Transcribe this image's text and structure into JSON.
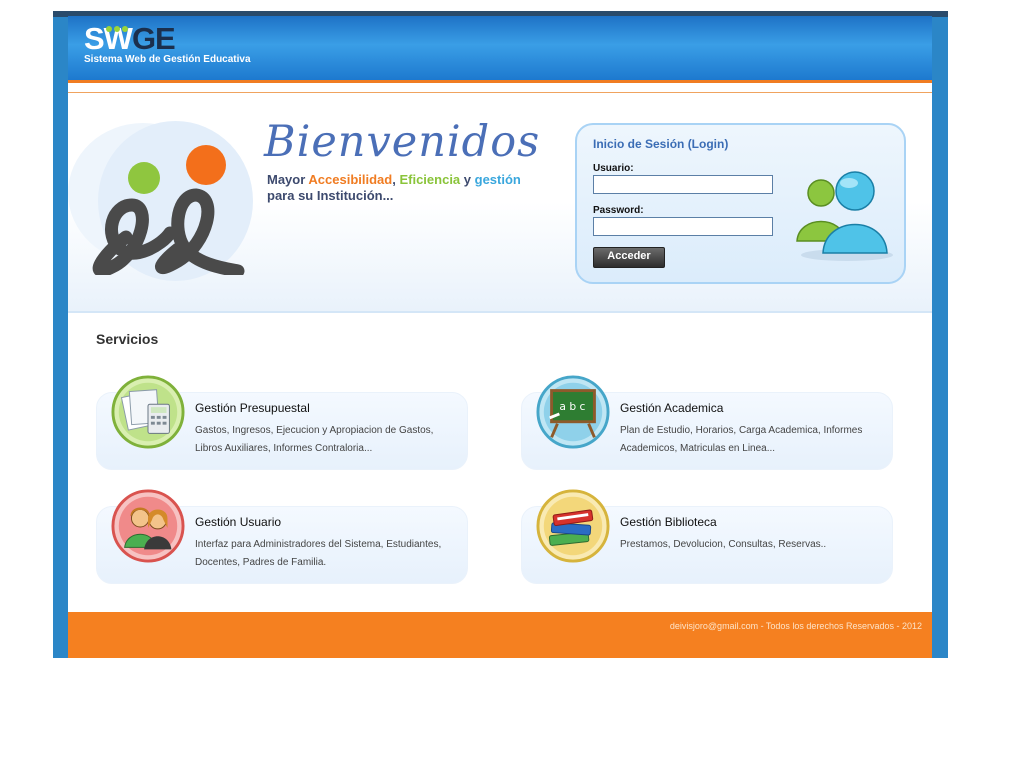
{
  "brand": {
    "logo_text_sw": "SW",
    "logo_text_ge": "GE",
    "subtitle": "Sistema Web de Gestión Educativa"
  },
  "hero": {
    "welcome": "Bienvenidos",
    "tagline": {
      "prefix": "Mayor ",
      "word1": "Accesibilidad",
      "sep1": ", ",
      "word2": "Eficiencia",
      "sep2": " y ",
      "word3": "gestión",
      "line2": "para su Institución..."
    }
  },
  "login": {
    "title": "Inicio de Sesión (Login)",
    "user_label": "Usuario:",
    "user_value": "",
    "password_label": "Password:",
    "password_value": "",
    "submit_label": "Acceder"
  },
  "services": {
    "title": "Servicios",
    "items": [
      {
        "title": "Gestión Presupuestal",
        "desc": "Gastos, Ingresos, Ejecucion y Apropiacion de Gastos, Libros Auxiliares, Informes Contraloria...",
        "icon": "calculator-icon"
      },
      {
        "title": "Gestión Academica",
        "desc": "Plan de Estudio, Horarios, Carga Academica, Informes Academicos, Matriculas en Linea...",
        "icon": "chalkboard-icon"
      },
      {
        "title": "Gestión Usuario",
        "desc": "Interfaz para Administradores del Sistema, Estudiantes, Docentes, Padres de Familia.",
        "icon": "users-icon"
      },
      {
        "title": "Gestión Biblioteca",
        "desc": "Prestamos, Devolucion, Consultas, Reservas..",
        "icon": "books-icon"
      }
    ]
  },
  "footer": {
    "text": "deivisjoro@gmail.com - Todos los derechos Reservados - 2012"
  },
  "colors": {
    "header_blue": "#2b86c7",
    "accent_orange": "#f58020",
    "login_title": "#3b6db5"
  }
}
